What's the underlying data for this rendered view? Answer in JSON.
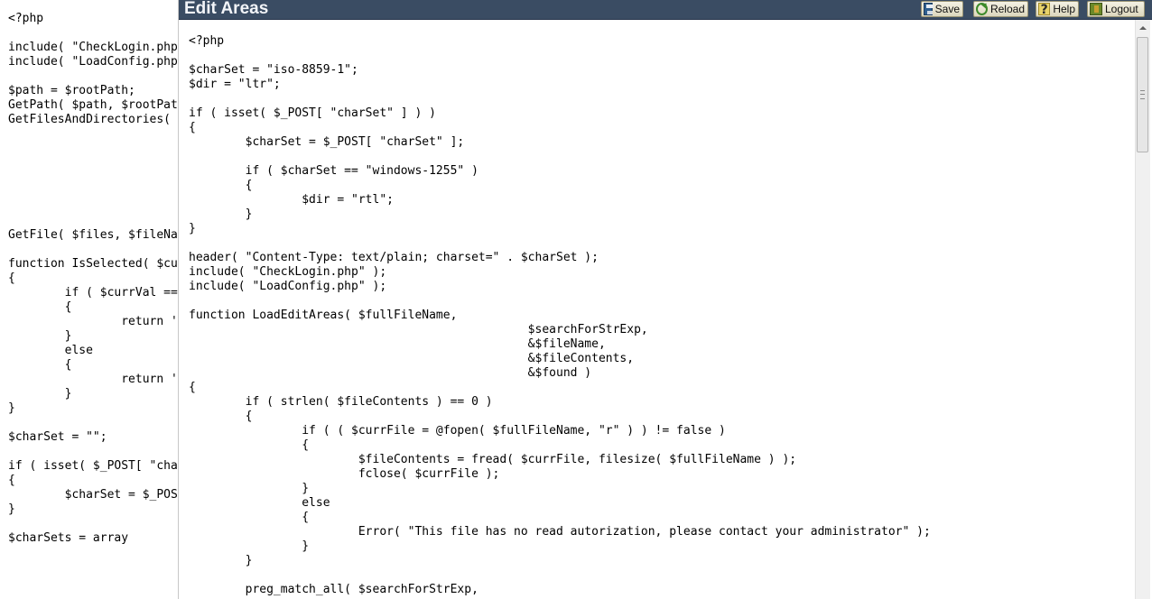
{
  "background_code": {
    "lines": [
      "<?php",
      "",
      "include( \"CheckLogin.php",
      "include( \"LoadConfig.php",
      "",
      "$path = $rootPath;",
      "GetPath( $path, $rootPat",
      "GetFilesAndDirectories(",
      "",
      "",
      "",
      "",
      "",
      "",
      "",
      "GetFile( $files, $fileNa",
      "",
      "function IsSelected( $cu",
      "{",
      "        if ( $currVal ==",
      "        {",
      "                return '",
      "        }",
      "        else",
      "        {",
      "                return '",
      "        }",
      "}",
      "",
      "$charSet = \"\";",
      "",
      "if ( isset( $_POST[ \"cha",
      "{",
      "        $charSet = $_POS",
      "}",
      "",
      "$charSets = array"
    ]
  },
  "window": {
    "title": "Edit Areas",
    "toolbar": {
      "save": "Save",
      "reload": "Reload",
      "help": "Help",
      "logout": "Logout"
    }
  },
  "editor": {
    "lines": [
      "<?php",
      "",
      "$charSet = \"iso-8859-1\";",
      "$dir = \"ltr\";",
      "",
      "if ( isset( $_POST[ \"charSet\" ] ) )",
      "{",
      "        $charSet = $_POST[ \"charSet\" ];",
      "",
      "        if ( $charSet == \"windows-1255\" )",
      "        {",
      "                $dir = \"rtl\";",
      "        }",
      "}",
      "",
      "header( \"Content-Type: text/plain; charset=\" . $charSet );",
      "include( \"CheckLogin.php\" );",
      "include( \"LoadConfig.php\" );",
      "",
      "function LoadEditAreas( $fullFileName,",
      "                                                $searchForStrExp,",
      "                                                &$fileName,",
      "                                                &$fileContents,",
      "                                                &$found )",
      "{",
      "        if ( strlen( $fileContents ) == 0 )",
      "        {",
      "                if ( ( $currFile = @fopen( $fullFileName, \"r\" ) ) != false )",
      "                {",
      "                        $fileContents = fread( $currFile, filesize( $fullFileName ) );",
      "                        fclose( $currFile );",
      "                }",
      "                else",
      "                {",
      "                        Error( \"This file has no read autorization, please contact your administrator\" );",
      "                }",
      "        }",
      "",
      "        preg_match_all( $searchForStrExp,"
    ]
  },
  "icons": {
    "save": "floppy-disk-icon",
    "reload": "reload-icon",
    "help": "help-icon",
    "logout": "logout-door-icon"
  },
  "colors": {
    "titlebar": "#3a4c63",
    "title_text": "#f2f4f8",
    "button_bg": "#e8e4cf"
  }
}
